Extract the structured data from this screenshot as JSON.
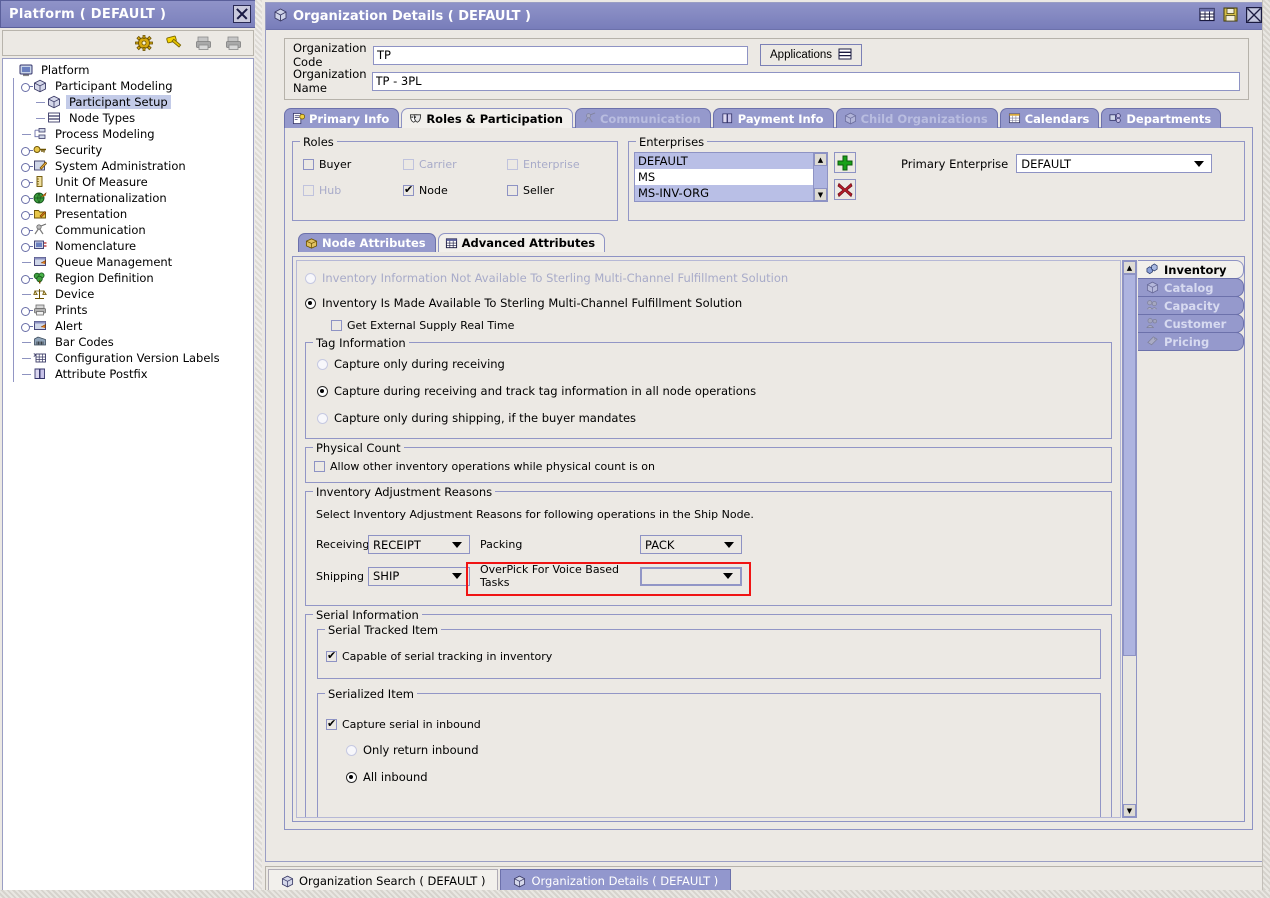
{
  "left_panel": {
    "title": "Platform ( DEFAULT )",
    "close_button": "close-icon",
    "toolbar": [
      {
        "name": "gear-icon",
        "glyph": "⚙"
      },
      {
        "name": "hammer-icon",
        "glyph": "🔨"
      },
      {
        "name": "print-icon",
        "glyph": "🖶"
      },
      {
        "name": "print-all-icon",
        "glyph": "🖶"
      }
    ],
    "tree": [
      {
        "label": "Platform",
        "depth": 0,
        "knob": "none",
        "icon": "computer-icon",
        "selected": false
      },
      {
        "label": "Participant Modeling",
        "depth": 1,
        "knob": "expanded",
        "icon": "cube-icon",
        "selected": false
      },
      {
        "label": "Participant Setup",
        "depth": 2,
        "knob": "leaf",
        "icon": "cube-icon",
        "selected": true
      },
      {
        "label": "Node Types",
        "depth": 2,
        "knob": "leaf",
        "icon": "list-icon",
        "selected": false
      },
      {
        "label": "Process Modeling",
        "depth": 1,
        "knob": "leaf",
        "icon": "flow-icon",
        "selected": false
      },
      {
        "label": "Security",
        "depth": 1,
        "knob": "collapsed",
        "icon": "key-icon",
        "selected": false
      },
      {
        "label": "System Administration",
        "depth": 1,
        "knob": "collapsed",
        "icon": "pencil-icon",
        "selected": false
      },
      {
        "label": "Unit Of Measure",
        "depth": 1,
        "knob": "collapsed",
        "icon": "ruler-icon",
        "selected": false
      },
      {
        "label": "Internationalization",
        "depth": 1,
        "knob": "collapsed",
        "icon": "globe-icon",
        "selected": false
      },
      {
        "label": "Presentation",
        "depth": 1,
        "knob": "collapsed",
        "icon": "folder-icon",
        "selected": false
      },
      {
        "label": "Communication",
        "depth": 1,
        "knob": "collapsed",
        "icon": "antenna-icon",
        "selected": false
      },
      {
        "label": "Nomenclature",
        "depth": 1,
        "knob": "collapsed",
        "icon": "monitor-icon",
        "selected": false
      },
      {
        "label": "Queue Management",
        "depth": 1,
        "knob": "leaf",
        "icon": "window-icon",
        "selected": false
      },
      {
        "label": "Region Definition",
        "depth": 1,
        "knob": "collapsed",
        "icon": "tree-icon",
        "selected": false
      },
      {
        "label": "Device",
        "depth": 1,
        "knob": "leaf",
        "icon": "scale-icon",
        "selected": false
      },
      {
        "label": "Prints",
        "depth": 1,
        "knob": "collapsed",
        "icon": "printer-icon",
        "selected": false
      },
      {
        "label": "Alert",
        "depth": 1,
        "knob": "collapsed",
        "icon": "alert-icon",
        "selected": false
      },
      {
        "label": "Bar Codes",
        "depth": 1,
        "knob": "leaf",
        "icon": "barcode-icon",
        "selected": false
      },
      {
        "label": "Configuration Version Labels",
        "depth": 1,
        "knob": "leaf",
        "icon": "grid-icon",
        "selected": false
      },
      {
        "label": "Attribute Postfix",
        "depth": 1,
        "knob": "leaf",
        "icon": "book-icon",
        "selected": false
      }
    ]
  },
  "main": {
    "title": "Organization Details ( DEFAULT )",
    "title_icon": "cube-icon",
    "titlebar_buttons": [
      {
        "name": "grid-view-icon",
        "glyph": "▤"
      },
      {
        "name": "save-icon",
        "glyph": "💾"
      },
      {
        "name": "close-icon",
        "glyph": "✕"
      }
    ],
    "org_code": {
      "label": "Organization Code",
      "value": "TP"
    },
    "org_name": {
      "label": "Organization Name",
      "value": "TP - 3PL"
    },
    "applications_button": {
      "label": "Applications",
      "icon": "list-icon"
    },
    "tabs": [
      {
        "label": "Primary Info",
        "icon": "info-icon",
        "state": "normal"
      },
      {
        "label": "Roles & Participation",
        "icon": "masks-icon",
        "state": "active"
      },
      {
        "label": "Communication",
        "icon": "antenna-icon",
        "state": "disabled"
      },
      {
        "label": "Payment Info",
        "icon": "book-icon",
        "state": "normal"
      },
      {
        "label": "Child Organizations",
        "icon": "cube-icon",
        "state": "disabled"
      },
      {
        "label": "Calendars",
        "icon": "calendar-icon",
        "state": "normal"
      },
      {
        "label": "Departments",
        "icon": "org-icon",
        "state": "normal"
      }
    ],
    "roles": {
      "legend": "Roles",
      "items": [
        {
          "label": "Buyer",
          "checked": false,
          "enabled": true
        },
        {
          "label": "Carrier",
          "checked": false,
          "enabled": false
        },
        {
          "label": "Enterprise",
          "checked": false,
          "enabled": false
        },
        {
          "label": "Hub",
          "checked": false,
          "enabled": false
        },
        {
          "label": "Node",
          "checked": true,
          "enabled": true
        },
        {
          "label": "Seller",
          "checked": false,
          "enabled": true
        }
      ]
    },
    "enterprises": {
      "legend": "Enterprises",
      "list": [
        {
          "value": "DEFAULT",
          "selected": true
        },
        {
          "value": "MS",
          "selected": false
        },
        {
          "value": "MS-INV-ORG",
          "selected": true
        }
      ],
      "add_button": "add-icon",
      "delete_button": "delete-icon",
      "primary_label": "Primary Enterprise",
      "primary_value": "DEFAULT"
    },
    "subtabs": [
      {
        "label": "Node Attributes",
        "icon": "box-icon",
        "state": "normal"
      },
      {
        "label": "Advanced Attributes",
        "icon": "table-icon",
        "state": "active"
      }
    ],
    "inventory": {
      "option_not_available": "Inventory Information Not Available To Sterling Multi-Channel Fulfillment Solution",
      "option_available": "Inventory Is Made Available To Sterling Multi-Channel Fulfillment Solution",
      "selected": "available",
      "get_external_supply": {
        "label": "Get External Supply Real Time",
        "checked": false
      }
    },
    "tag_information": {
      "legend": "Tag Information",
      "options": [
        {
          "label": "Capture only during receiving",
          "selected": false,
          "enabled": false
        },
        {
          "label": "Capture during receiving and track tag information in all node operations",
          "selected": true,
          "enabled": true
        },
        {
          "label": "Capture only during shipping, if the buyer mandates",
          "selected": false,
          "enabled": false
        }
      ]
    },
    "physical_count": {
      "legend": "Physical Count",
      "checkbox": {
        "label": "Allow other inventory operations while physical count is on",
        "checked": false
      }
    },
    "inventory_adjustment": {
      "legend": "Inventory Adjustment Reasons",
      "description": "Select Inventory Adjustment Reasons for following operations in the Ship Node.",
      "fields": [
        {
          "label": "Receiving",
          "value": "RECEIPT"
        },
        {
          "label": "Packing",
          "value": "PACK"
        },
        {
          "label": "Shipping",
          "value": "SHIP"
        },
        {
          "label": "OverPick  For  Voice  Based  Tasks",
          "value": "",
          "highlighted": true
        }
      ]
    },
    "serial_information": {
      "legend": "Serial Information",
      "serial_tracked": {
        "legend": "Serial Tracked Item",
        "checkbox": {
          "label": "Capable of serial tracking in inventory",
          "checked": true
        }
      },
      "serialized": {
        "legend": "Serialized Item",
        "checkbox": {
          "label": "Capture serial in inbound",
          "checked": true
        },
        "options": [
          {
            "label": "Only return inbound",
            "selected": false,
            "enabled": false
          },
          {
            "label": "All inbound",
            "selected": true,
            "enabled": true
          }
        ]
      }
    },
    "side_tabs": [
      {
        "label": "Inventory",
        "icon": "inventory-icon",
        "state": "active"
      },
      {
        "label": "Catalog",
        "icon": "cube-icon",
        "state": "disabled"
      },
      {
        "label": "Capacity",
        "icon": "capacity-icon",
        "state": "disabled"
      },
      {
        "label": "Customer",
        "icon": "people-icon",
        "state": "disabled"
      },
      {
        "label": "Pricing",
        "icon": "tag-icon",
        "state": "disabled"
      }
    ]
  },
  "taskbar": [
    {
      "label": "Organization Search ( DEFAULT )",
      "icon": "cube-icon",
      "active": false
    },
    {
      "label": "Organization Details ( DEFAULT )",
      "icon": "cube-icon",
      "active": true
    }
  ],
  "colors": {
    "titlebar": "#8f93c8",
    "tab_inactive": "#9599cc",
    "tab_active": "#f2f0ec",
    "selection": "#b9bfe6",
    "highlight": "#f01414",
    "panel_bg": "#ece9e4",
    "border": "#8e93c4"
  }
}
